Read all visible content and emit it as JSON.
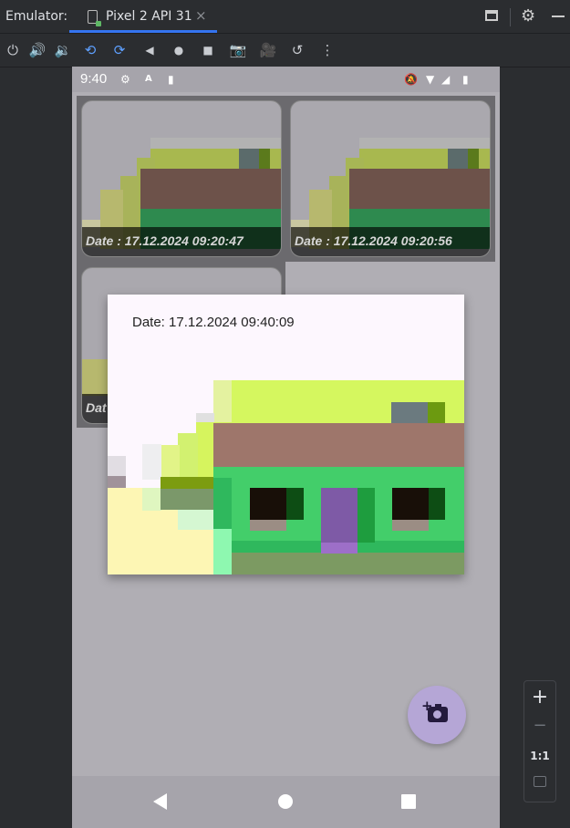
{
  "window": {
    "label": "Emulator:",
    "tab_name": "Pixel 2 API 31",
    "tab_close": "×",
    "accent_color": "#3574f0"
  },
  "toolbar": {
    "icons": [
      "power-icon",
      "volume-up-icon",
      "volume-down-icon",
      "rotate-left-icon",
      "rotate-right-icon",
      "back-icon",
      "home-icon",
      "overview-icon",
      "screenshot-icon",
      "record-icon",
      "snapshot-icon",
      "more-icon"
    ]
  },
  "device": {
    "status_bar": {
      "time": "9:40"
    },
    "gallery": {
      "cards": [
        {
          "date": "Date : 17.12.2024 09:20:47"
        },
        {
          "date": "Date : 17.12.2024 09:20:56"
        },
        {
          "date": "Dat"
        }
      ]
    },
    "dialog": {
      "title": "Date: 17.12.2024 09:40:09"
    },
    "fab": {
      "icon": "add-photo-icon",
      "color": "#b5a6d6"
    }
  },
  "zoom_panel": {
    "zoom_in": "+",
    "zoom_out": "−",
    "actual_size": "1:1"
  }
}
